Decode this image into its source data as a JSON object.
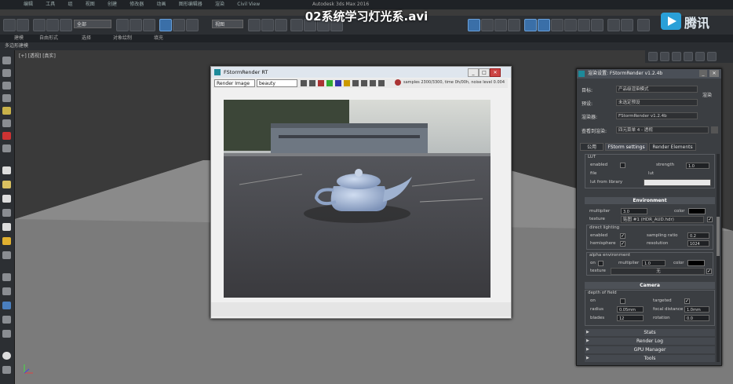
{
  "video_title": "02系统学习灯光系.avi",
  "logo_text": "腾讯",
  "app_title": "Autodesk 3ds Max 2016",
  "menu_items": [
    "编辑",
    "工具",
    "组",
    "视图",
    "创建",
    "修改器",
    "动画",
    "图形编辑器",
    "渲染",
    "Civil View"
  ],
  "toolbar": {
    "selection_filter": "全部",
    "view_dropdown": "视图"
  },
  "ribbon_tabs": [
    "建模",
    "自由形式",
    "选择",
    "对象绘制",
    "填充"
  ],
  "sub_ribbon": "多边形建模",
  "viewport_label": "[+] [透视] [真实]",
  "render_frame": {
    "title": "FStormRender RT",
    "channel_dropdown": "Render Image",
    "preset_dropdown": "beauty",
    "status": "samples 2300/3300, time 0h/00h, noise level 0.004"
  },
  "render_setup": {
    "title": "渲染设置: FStormRender v1.2.4b",
    "rows": [
      {
        "label": "目标:",
        "value": "产品级渲染模式"
      },
      {
        "label": "预设:",
        "value": "未选定预设"
      },
      {
        "label": "渲染器:",
        "value": "FStormRender v1.2.4b"
      },
      {
        "label": "查看到渲染:",
        "value": "四元菜单 4 - 透视"
      }
    ],
    "render_button": "渲染",
    "tabs": [
      "公用",
      "FStorm settings",
      "Render Elements"
    ],
    "lut": {
      "title": "LUT",
      "enabled_label": "enabled",
      "strength_label": "strength",
      "strength_value": "1.0",
      "file_label": "file",
      "file_value": "lut",
      "lut_from_library_label": "lut from library"
    },
    "environment": {
      "title": "Environment",
      "multiplier_label": "multiplier",
      "multiplier_value": "3.0",
      "color_label": "color",
      "texture_label": "texture",
      "texture_value": "贴图 #1 (HDR_AUD.hdr)",
      "direct_lighting_label": "direct lighting",
      "enabled_label": "enabled",
      "sampling_ratio_label": "sampling ratio",
      "sampling_ratio_value": "0.2",
      "hemisphere_label": "hemisphere",
      "resolution_label": "resolution",
      "resolution_value": "1024",
      "alpha_env_label": "alpha environment",
      "on_label": "on",
      "alpha_multiplier_label": "multiplier",
      "alpha_multiplier_value": "1.0",
      "alpha_color_label": "color",
      "alpha_texture_label": "texture",
      "alpha_texture_value": "无"
    },
    "camera": {
      "title": "Camera",
      "dof_label": "depth of field",
      "on_label": "on",
      "targeted_label": "targeted",
      "radius_label": "radius",
      "radius_value": "0.05mm",
      "focal_label": "focal distance",
      "focal_value": "1.0mm",
      "blades_label": "blades",
      "blades_value": "12",
      "rotation_label": "rotation",
      "rotation_value": "0.0"
    },
    "rollouts": [
      "Stats",
      "Render Log",
      "GPU Manager",
      "Tools"
    ]
  }
}
